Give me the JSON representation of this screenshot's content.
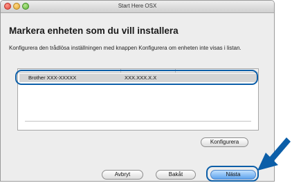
{
  "window": {
    "title": "Start Here OSX"
  },
  "content": {
    "heading": "Markera enheten som du vill installera",
    "instruction": "Konfigurera den trådlösa inställningen med knappen Konfigurera om enheten inte visas i listan."
  },
  "device_list": {
    "rows": [
      {
        "name": "Brother XXX-XXXXX",
        "address": "XXX.XXX.X.X",
        "selected": true
      }
    ]
  },
  "buttons": {
    "configure": "Konfigurera",
    "cancel": "Avbryt",
    "back": "Bakåt",
    "next": "Nästa"
  },
  "colors": {
    "highlight": "#0b5ea8",
    "default_button": "#5ea2ec",
    "selection": "#d4d4d4"
  }
}
